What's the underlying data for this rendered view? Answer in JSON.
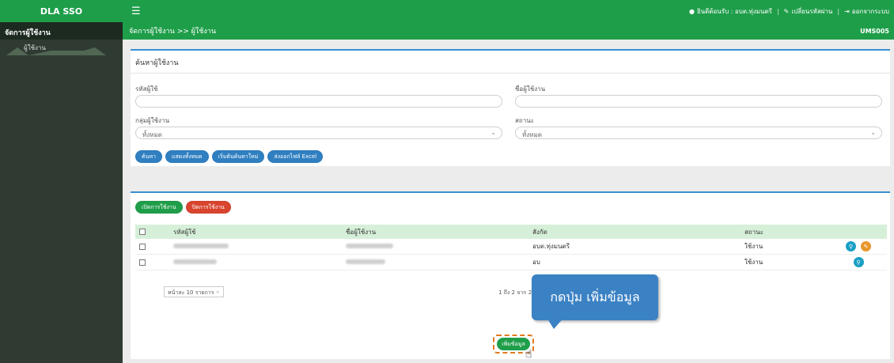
{
  "app": {
    "brand": "DLA SSO"
  },
  "topbar": {
    "menu_icon": "hamburger-icon",
    "welcome": "ยินดีต้อนรับ : อบต.ทุ่งมนตรี",
    "change_password": "เปลี่ยนรหัสผ่าน",
    "logout": "ออกจากระบบ"
  },
  "sidebar": {
    "heading": "จัดการผู้ใช้งาน",
    "items": [
      {
        "label": "ผู้ใช้งาน"
      }
    ]
  },
  "breadcrumb": {
    "text": "จัดการผู้ใช้งาน >> ผู้ใช้งาน",
    "code": "UMS005"
  },
  "search": {
    "title": "ค้นหาผู้ใช้งาน",
    "user_id_label": "รหัสผู้ใช้",
    "user_id_value": "",
    "user_name_label": "ชื่อผู้ใช้งาน",
    "user_name_value": "",
    "group_label": "กลุ่มผู้ใช้งาน",
    "group_value": "ทั้งหมด",
    "status_label": "สถานะ",
    "status_value": "ทั้งหมด",
    "buttons": {
      "search": "ค้นหา",
      "show_all": "แสดงทั้งหมด",
      "reset": "เริ่มต้นค้นหาใหม่",
      "export": "ส่งออกไฟล์ Excel"
    }
  },
  "results": {
    "enable_button": "เปิดการใช้งาน",
    "disable_button": "ปิดการใช้งาน",
    "columns": [
      "รหัสผู้ใช้",
      "ชื่อผู้ใช้งาน",
      "สังกัด",
      "สถานะ"
    ],
    "rows": [
      {
        "agency": "อบต.ทุ่งมนตรี",
        "status": "ใช้งาน"
      },
      {
        "agency": "อบ",
        "status": "ใช้งาน"
      }
    ],
    "page_size": "หน้าละ 10 รายการ",
    "page_info": "1 ถึง 2 จาก 2",
    "add_button": "เพิ่มข้อมูล"
  },
  "annotation": {
    "callout": "กดปุ่ม เพิ่มข้อมูล"
  },
  "colors": {
    "primary_green": "#1f9e4a",
    "accent_blue": "#3a8fd0",
    "danger_red": "#d9442e",
    "callout_blue": "#3b82c4"
  }
}
